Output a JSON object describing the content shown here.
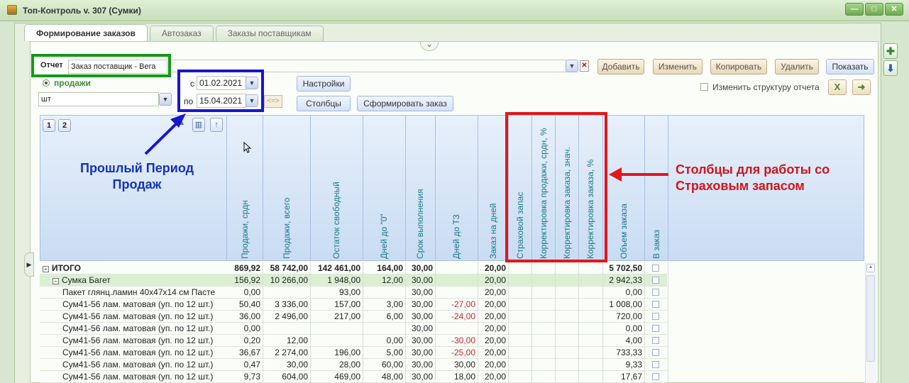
{
  "window": {
    "title": "Топ-Контроль v. 307 (Сумки)",
    "buttons": [
      "—",
      "□",
      "✕"
    ]
  },
  "tabs": [
    {
      "label": "Формирование заказов",
      "active": true
    },
    {
      "label": "Автозаказ",
      "active": false
    },
    {
      "label": "Заказы поставщикам",
      "active": false
    }
  ],
  "report": {
    "label": "Отчет",
    "value": "Заказ поставщик - Вега"
  },
  "toolbar": {
    "add": "Добавить",
    "edit": "Изменить",
    "copy": "Копировать",
    "delete": "Удалить",
    "show": "Показать"
  },
  "filters": {
    "mode_label": "продажи",
    "unit": "шт",
    "from_label": "с",
    "from_date": "01.02.2021",
    "to_label": "по",
    "to_date": "15.04.2021",
    "shift": "<=>"
  },
  "actions": {
    "settings": "Настройки",
    "columns": "Столбцы",
    "form_order": "Сформировать заказ",
    "change_structure": "Изменить структуру отчета"
  },
  "grid": {
    "pages": [
      "1",
      "2"
    ],
    "columns": [
      "Продажи, срдн",
      "Продажи, всего",
      "Остаток свободный",
      "Дней до \"0\"",
      "Срок выполнения",
      "Дней до ТЗ",
      "Заказ на дней",
      "Страховой запас",
      "Корректировка продажи, срдн, %",
      "Корректировка заказа, знач.",
      "Корректировка заказа, %",
      "Объем заказа",
      "В заказ"
    ],
    "rows": [
      {
        "name": "ИТОГО",
        "level": 0,
        "toggle": "−",
        "bold": true,
        "cells": [
          "869,92",
          "58 742,00",
          "142 461,00",
          "164,00",
          "30,00",
          "",
          "20,00",
          "",
          "",
          "",
          "",
          "5 702,50"
        ]
      },
      {
        "name": "Сумка Багет",
        "level": 1,
        "toggle": "−",
        "group": true,
        "cells": [
          "156,92",
          "10 266,00",
          "1 948,00",
          "12,00",
          "30,00",
          "",
          "20,00",
          "",
          "",
          "",
          "",
          "2 942,33"
        ]
      },
      {
        "name": "Пакет глянц.ламин 40x47x14 см Пасте",
        "level": 2,
        "cells": [
          "0,00",
          "",
          "93,00",
          "",
          "30,00",
          "",
          "20,00",
          "",
          "",
          "",
          "",
          "0,00"
        ]
      },
      {
        "name": "Сум41-56 лам. матовая  (уп. по 12 шт.)",
        "level": 2,
        "cells": [
          "50,40",
          "3 336,00",
          "157,00",
          "3,00",
          "30,00",
          "-27,00",
          "20,00",
          "",
          "",
          "",
          "",
          "1 008,00"
        ]
      },
      {
        "name": "Сум41-56 лам. матовая  (уп. по 12 шт.)",
        "level": 2,
        "cells": [
          "36,00",
          "2 496,00",
          "217,00",
          "6,00",
          "30,00",
          "-24,00",
          "20,00",
          "",
          "",
          "",
          "",
          "720,00"
        ]
      },
      {
        "name": "Сум41-56 лам. матовая  (уп. по 12 шт.)",
        "level": 2,
        "cells": [
          "0,00",
          "",
          "",
          "",
          "30,00",
          "",
          "20,00",
          "",
          "",
          "",
          "",
          "0,00"
        ]
      },
      {
        "name": "Сум41-56 лам. матовая  (уп. по 12 шт.)",
        "level": 2,
        "cells": [
          "0,20",
          "12,00",
          "",
          "0,00",
          "30,00",
          "-30,00",
          "20,00",
          "",
          "",
          "",
          "",
          "4,00"
        ]
      },
      {
        "name": "Сум41-56 лам. матовая  (уп. по 12 шт.)",
        "level": 2,
        "cells": [
          "36,67",
          "2 274,00",
          "196,00",
          "5,00",
          "30,00",
          "-25,00",
          "20,00",
          "",
          "",
          "",
          "",
          "733,33"
        ]
      },
      {
        "name": "Сум41-56 лам. матовая  (уп. по 12 шт.)",
        "level": 2,
        "cells": [
          "0,47",
          "30,00",
          "28,00",
          "60,00",
          "30,00",
          "30,00",
          "20,00",
          "",
          "",
          "",
          "",
          "9,33"
        ]
      },
      {
        "name": "Сум41-56 лам. матовая  (уп. по 12 шт.)",
        "level": 2,
        "cells": [
          "9,73",
          "604,00",
          "469,00",
          "48,00",
          "30,00",
          "18,00",
          "20,00",
          "",
          "",
          "",
          "",
          "17,67"
        ]
      }
    ]
  },
  "annotations": {
    "blue": [
      "Прошлый Период",
      "Продаж"
    ],
    "red": [
      "Столбцы для работы со",
      "Страховым запасом"
    ],
    "colors": {
      "blue": "#1616cf",
      "red": "#e2161b",
      "green": "#139b15"
    }
  }
}
